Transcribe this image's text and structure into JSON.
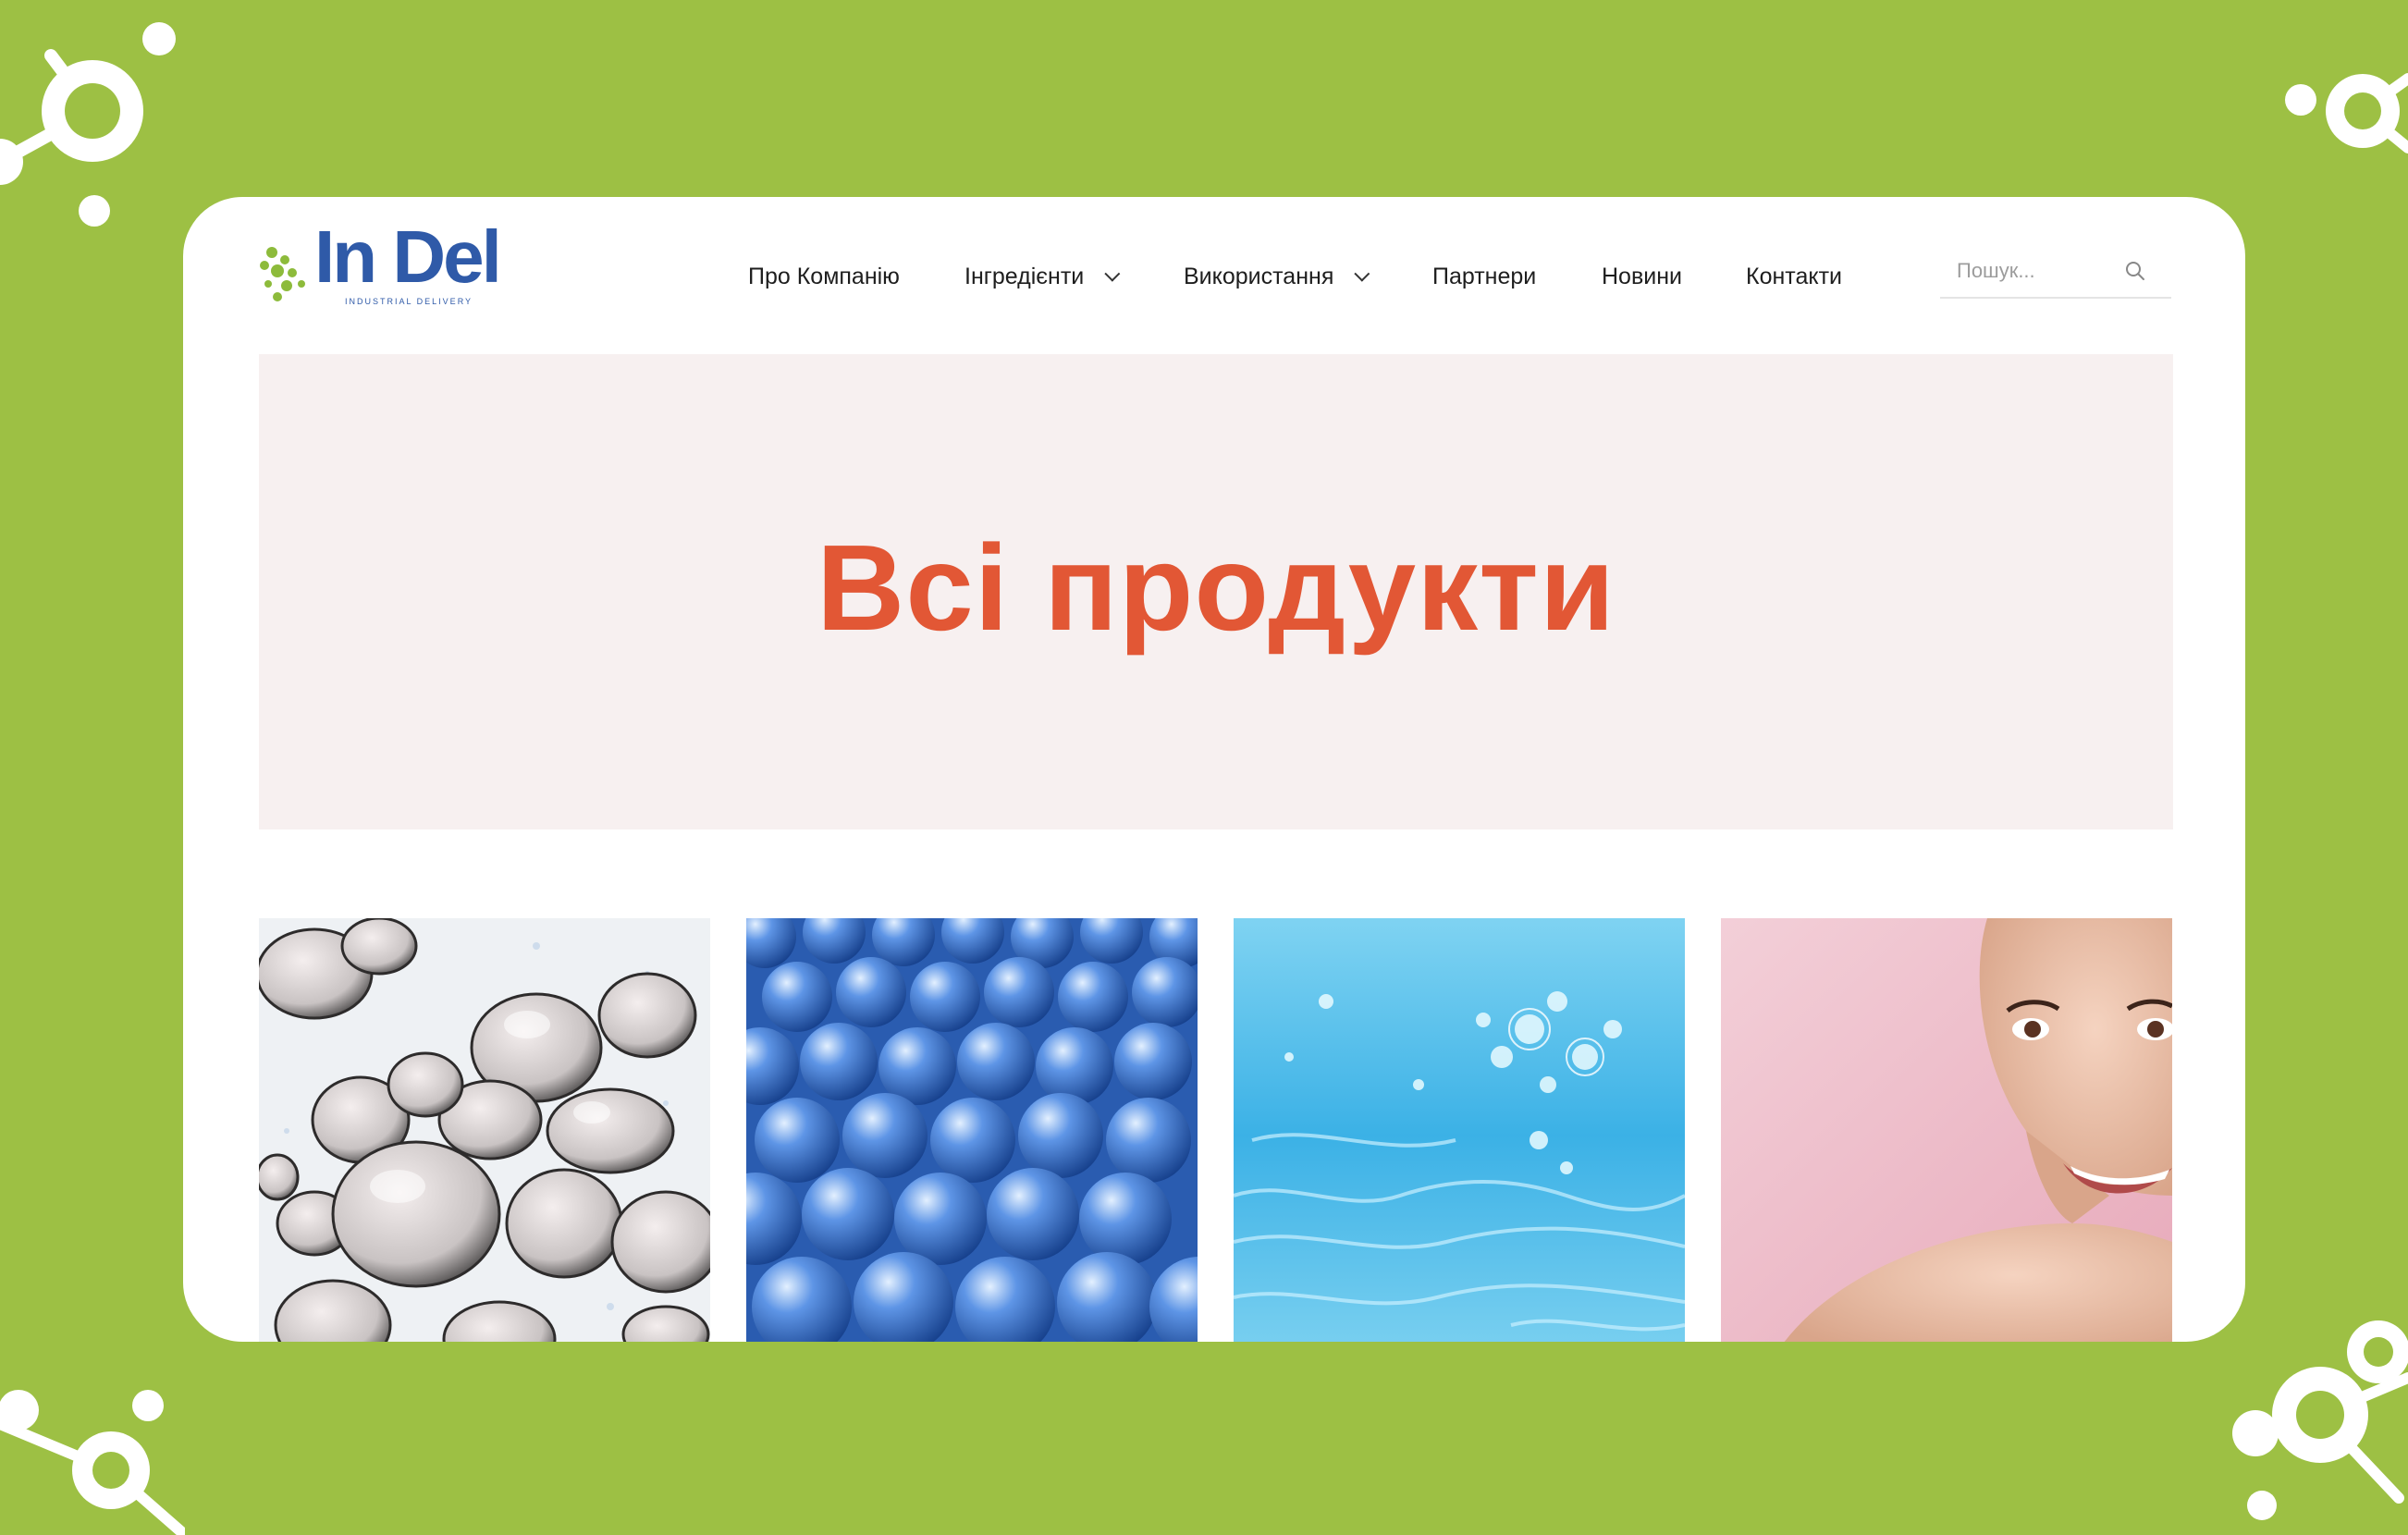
{
  "brand": {
    "name": "In Del",
    "tagline": "INDUSTRIAL DELIVERY",
    "colors": {
      "primary": "#2f5aa8",
      "accent": "#8dbb3b",
      "title": "#e25735",
      "frame": "#9dc044"
    }
  },
  "nav": {
    "items": [
      {
        "label": "Про Компанію",
        "has_dropdown": false
      },
      {
        "label": "Інгредієнти",
        "has_dropdown": true
      },
      {
        "label": "Використання",
        "has_dropdown": true
      },
      {
        "label": "Партнери",
        "has_dropdown": false
      },
      {
        "label": "Новини",
        "has_dropdown": false
      },
      {
        "label": "Контакти",
        "has_dropdown": false
      }
    ]
  },
  "search": {
    "placeholder": "Пошук...",
    "icon": "search-icon"
  },
  "hero": {
    "title": "Всі продукти"
  },
  "products": [
    {
      "image": "yeast-cells"
    },
    {
      "image": "blue-gel-spheres"
    },
    {
      "image": "water-bubbles"
    },
    {
      "image": "smiling-woman"
    }
  ]
}
